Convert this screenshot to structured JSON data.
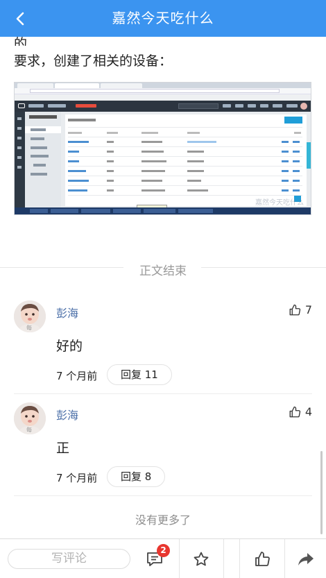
{
  "header": {
    "title": "嘉然今天吃什么"
  },
  "article": {
    "line_partial": "的",
    "line_full": "要求，创建了相关的设备：",
    "screenshot_watermark": "嘉然今天吃什么"
  },
  "divider": {
    "label": "正文结束"
  },
  "comments": [
    {
      "author": "彭海",
      "likes": "7",
      "body": "好的",
      "time": "7 个月前",
      "reply_label": "回复 11"
    },
    {
      "author": "彭海",
      "likes": "4",
      "body": "正",
      "time": "7 个月前",
      "reply_label": "回复 8"
    }
  ],
  "footer": {
    "no_more": "没有更多了"
  },
  "bottom_bar": {
    "comment_placeholder": "写评论",
    "comment_count_badge": "2",
    "icons": [
      "comment-icon",
      "star-icon",
      "thumbs-up-icon",
      "share-icon"
    ]
  },
  "colors": {
    "header": "#3b94f0",
    "author": "#4b6fa8",
    "badge": "#e8362f"
  }
}
